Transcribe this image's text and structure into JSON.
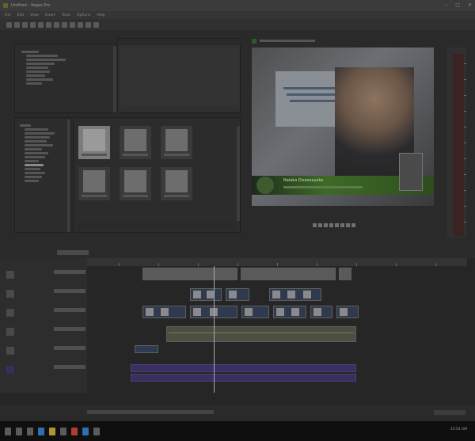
{
  "window": {
    "title": "Untitled - Vegas Pro",
    "controls": [
      "–",
      "□",
      "✕"
    ]
  },
  "menu": {
    "items": [
      "File",
      "Edit",
      "View",
      "Insert",
      "Tools",
      "Options",
      "Help"
    ]
  },
  "preview": {
    "lower_third_name": "Nalaka Dissanayake"
  },
  "tray": {
    "time": "10:54 AM"
  },
  "icons": {
    "app": "vegas-app-icon",
    "start": "windows-start-icon"
  }
}
